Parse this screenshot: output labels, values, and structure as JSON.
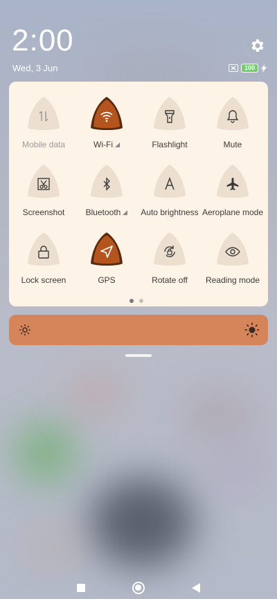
{
  "status": {
    "time": "2:00",
    "date": "Wed, 3 Jun",
    "battery": "100"
  },
  "colors": {
    "accent": "#d6855a",
    "active_tile": "#b4541f",
    "panel_bg": "#fdf3e6",
    "inactive_tile": "#ecdfd0"
  },
  "tiles": [
    {
      "label": "Mobile data",
      "icon": "mobile-data-icon",
      "active": false,
      "dim": true,
      "arrow": false
    },
    {
      "label": "Wi-Fi",
      "icon": "wifi-icon",
      "active": true,
      "dim": false,
      "arrow": true
    },
    {
      "label": "Flashlight",
      "icon": "flashlight-icon",
      "active": false,
      "dim": false,
      "arrow": false
    },
    {
      "label": "Mute",
      "icon": "bell-icon",
      "active": false,
      "dim": false,
      "arrow": false
    },
    {
      "label": "Screenshot",
      "icon": "screenshot-icon",
      "active": false,
      "dim": false,
      "arrow": false
    },
    {
      "label": "Bluetooth",
      "icon": "bluetooth-icon",
      "active": false,
      "dim": false,
      "arrow": true
    },
    {
      "label": "Auto brightness",
      "icon": "auto-brightness-icon",
      "active": false,
      "dim": false,
      "arrow": false
    },
    {
      "label": "Aeroplane mode",
      "icon": "airplane-icon",
      "active": false,
      "dim": false,
      "arrow": false
    },
    {
      "label": "Lock screen",
      "icon": "lock-icon",
      "active": false,
      "dim": false,
      "arrow": false
    },
    {
      "label": "GPS",
      "icon": "location-arrow-icon",
      "active": true,
      "dim": false,
      "arrow": false
    },
    {
      "label": "Rotate off",
      "icon": "rotate-lock-icon",
      "active": false,
      "dim": false,
      "arrow": false
    },
    {
      "label": "Reading mode",
      "icon": "eye-icon",
      "active": false,
      "dim": false,
      "arrow": false
    }
  ],
  "pager": {
    "pages": 2,
    "current": 0
  },
  "brightness": {
    "level": 1.0
  }
}
